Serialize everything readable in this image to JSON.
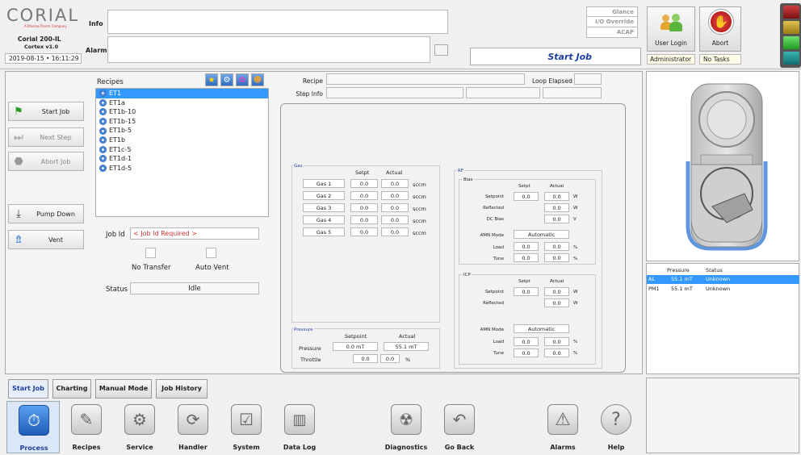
{
  "brand": {
    "logo_text": "CORIAL",
    "logo_sub": "A Plasma-Therm Company",
    "model": "Corial 200-IL",
    "version": "Cortex v1.0",
    "datetime": "2019-08-15 • 16:11:29"
  },
  "header": {
    "info_label": "Info",
    "alarm_label": "Alarm",
    "glance": "Glance",
    "io_override": "I/O Override",
    "acap": "ACAP",
    "page_title": "Start Job"
  },
  "user": {
    "login_label": "User Login",
    "abort_label": "Abort",
    "user_name": "Administrator",
    "tasks": "No Tasks"
  },
  "colors": {
    "accent": "#1f3fa0",
    "selection": "#3399ff",
    "machine_glow": "#3b7bd8"
  },
  "sidebar": {
    "start_job": "Start Job",
    "next_step": "Next Step",
    "abort_job": "Abort Job",
    "pump_down": "Pump Down",
    "vent": "Vent"
  },
  "recipes": {
    "label": "Recipes",
    "items": [
      "ET1",
      "ET1a",
      "ET1b-10",
      "ET1b-15",
      "ET1b-5",
      "ET1b",
      "ET1c-5",
      "ET1d-1",
      "ET1d-5"
    ]
  },
  "job": {
    "job_id_label": "Job Id",
    "job_id_placeholder": "< Job Id Required >",
    "no_transfer": "No Transfer",
    "auto_vent": "Auto Vent",
    "status_label": "Status",
    "status_value": "Idle"
  },
  "step": {
    "recipe_label": "Recipe",
    "loop_elapsed_label": "Loop Elapsed",
    "step_info_label": "Step Info"
  },
  "gas": {
    "title": "Gas",
    "setpt": "Setpt",
    "actual": "Actual",
    "rows": [
      {
        "name": "Gas 1",
        "setpt": "0.0",
        "actual": "0.0",
        "unit": "sccm"
      },
      {
        "name": "Gas 2",
        "setpt": "0.0",
        "actual": "0.0",
        "unit": "sccm"
      },
      {
        "name": "Gas 3",
        "setpt": "0.0",
        "actual": "0.0",
        "unit": "sccm"
      },
      {
        "name": "Gas 4",
        "setpt": "0.0",
        "actual": "0.0",
        "unit": "sccm"
      },
      {
        "name": "Gas 5",
        "setpt": "0.0",
        "actual": "0.0",
        "unit": "sccm"
      }
    ]
  },
  "pressure": {
    "title": "Pressure",
    "setpoint": "Setpoint",
    "actual": "Actual",
    "pressure_label": "Pressure",
    "pressure_set": "0.0 mT",
    "pressure_act": "55.1 mT",
    "throttle_label": "Throttle",
    "throttle_set": "0.0",
    "throttle_act": "0.0",
    "throttle_unit": "%"
  },
  "rf": {
    "title": "RF",
    "bias": "Bias",
    "setpt": "Setpt",
    "actual": "Actual",
    "setpoint_label": "Setpoint",
    "bias_set": "0.0",
    "bias_act": "0.0",
    "w": "W",
    "reflected_label": "Reflected",
    "bias_refl": "0.0",
    "dc_bias_label": "DC Bias",
    "dc_bias": "0.0",
    "v": "V",
    "amn_mode_label": "AMN Mode",
    "amn_mode": "Automatic",
    "load_label": "Load",
    "load_set": "0.0",
    "load_act": "0.0",
    "pct": "%",
    "tune_label": "Tune",
    "tune_set": "0.0",
    "tune_act": "0.0",
    "icp": "ICP",
    "icp_set": "0.0",
    "icp_act": "0.0",
    "icp_refl": "0.0",
    "icp_amn_mode": "Automatic",
    "icp_load_set": "0.0",
    "icp_load_act": "0.0",
    "icp_tune_set": "0.0",
    "icp_tune_act": "0.0"
  },
  "status_table": {
    "headers": [
      "",
      "Pressure",
      "Status"
    ],
    "rows": [
      {
        "id": "AL",
        "pressure": "55.1 mT",
        "status": "Unknown"
      },
      {
        "id": "PM1",
        "pressure": "55.1 mT",
        "status": "Unknown"
      }
    ]
  },
  "tabs": [
    "Start Job",
    "Charting",
    "Manual Mode",
    "Job History"
  ],
  "nav": [
    "Process",
    "Recipes",
    "Service",
    "Handler",
    "System",
    "Data Log",
    "Diagnostics",
    "Go Back",
    "Alarms",
    "Help"
  ]
}
